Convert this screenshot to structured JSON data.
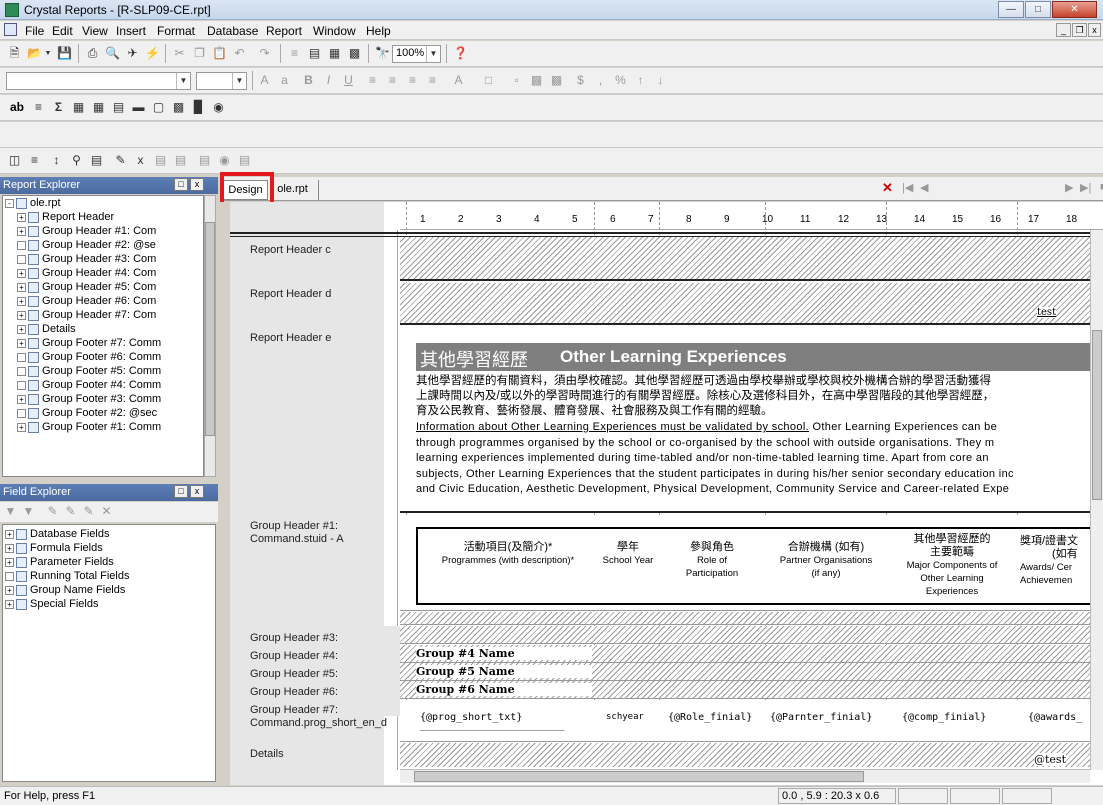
{
  "window": {
    "title": "Crystal Reports - [R-SLP09-CE.rpt]"
  },
  "menu": [
    "File",
    "Edit",
    "View",
    "Insert",
    "Format",
    "Database",
    "Report",
    "Window",
    "Help"
  ],
  "toolbar": {
    "zoom": "100%"
  },
  "report_explorer": {
    "title": "Report Explorer",
    "root": "ole.rpt",
    "items": [
      "Report Header",
      "Group Header #1: Com",
      "Group Header #2: @se",
      "Group Header #3: Com",
      "Group Header #4: Com",
      "Group Header #5: Com",
      "Group Header #6: Com",
      "Group Header #7: Com",
      "Details",
      "Group Footer #7: Comm",
      "Group Footer #6: Comm",
      "Group Footer #5: Comm",
      "Group Footer #4: Comm",
      "Group Footer #3: Comm",
      "Group Footer #2: @sec",
      "Group Footer #1: Comm"
    ]
  },
  "field_explorer": {
    "title": "Field Explorer",
    "items": [
      "Database Fields",
      "Formula Fields",
      "Parameter Fields",
      "Running Total Fields",
      "Group Name Fields",
      "Special Fields"
    ]
  },
  "tabs": {
    "design": "Design",
    "preview": "ole.rpt"
  },
  "ruler": [
    "1",
    "2",
    "3",
    "4",
    "5",
    "6",
    "7",
    "8",
    "9",
    "10",
    "11",
    "12",
    "13",
    "14",
    "15",
    "16",
    "17",
    "18"
  ],
  "sections": {
    "rhc": "Report Header c",
    "rhd": "Report Header d",
    "rhe": "Report Header e",
    "gh1": "Group Header #1:\nCommand.stuid - A",
    "gh3": "Group Header #3:",
    "gh4": "Group Header #4:",
    "gh5": "Group Header #5:",
    "gh6": "Group Header #6:",
    "gh7": "Group Header #7:\nCommand.prog_short_en_d",
    "details": "Details"
  },
  "report": {
    "test_label": "test",
    "ole_title_zh": "其他學習經歷",
    "ole_title_en": "Other Learning Experiences",
    "desc_zh_1": "其他學習經歷的有關資料，須由學校確認。其他學習經歷可透過由學校舉辦或學校與校外機構合辦的學習活動獲得",
    "desc_zh_2": "上課時間以內及/或以外的學習時間進行的有關學習經歷。除核心及選修科目外，在高中學習階段的其他學習經歷，",
    "desc_zh_3": "育及公民教育、藝術發展、體育發展、社會服務及與工作有關的經驗。",
    "desc_en_underline": "Information about Other Learning Experiences must be validated by school.",
    "desc_en_1": " Other Learning Experiences can be",
    "desc_en_2": "through programmes organised by the school or co-organised by the school with outside organisations. They m",
    "desc_en_3": "learning experiences implemented during time-tabled and/or non-time-tabled learning time. Apart from core an",
    "desc_en_4": "subjects, Other Learning Experiences that the student participates in during his/her senior secondary education inc",
    "desc_en_5": "and Civic Education, Aesthetic Development, Physical Development, Community Service and Career-related Expe",
    "col1_zh": "活動項目(及簡介)*",
    "col1_en": "Programmes (with description)*",
    "col2_zh": "學年",
    "col2_en": "School Year",
    "col3_zh": "參與角色",
    "col3_en1": "Role of",
    "col3_en2": "Participation",
    "col4_zh": "合辦機構 (如有)",
    "col4_en1": "Partner Organisations",
    "col4_en2": "(if any)",
    "col5_zh1": "其他學習經歷的",
    "col5_zh2": "主要範疇",
    "col5_en1": "Major Components of",
    "col5_en2": "Other Learning",
    "col5_en3": "Experiences",
    "col6_zh": "獎項/證書文",
    "col6_zh2": "(如有",
    "col6_en1": "Awards/ Cer",
    "col6_en2": "Achievemen",
    "grp4": "Group #4 Name",
    "grp5": "Group #5 Name",
    "grp6": "Group #6 Name",
    "f1": "{@prog_short_txt}",
    "f2": "schyear",
    "f3": "{@Role_finial}",
    "f4": "{@Parnter_finial}",
    "f5": "{@comp_finial}",
    "f6": "{@awards_",
    "det_test": "@test"
  },
  "status": {
    "help": "For Help, press F1",
    "coords": "0.0 , 5.9 : 20.3 x 0.6"
  }
}
